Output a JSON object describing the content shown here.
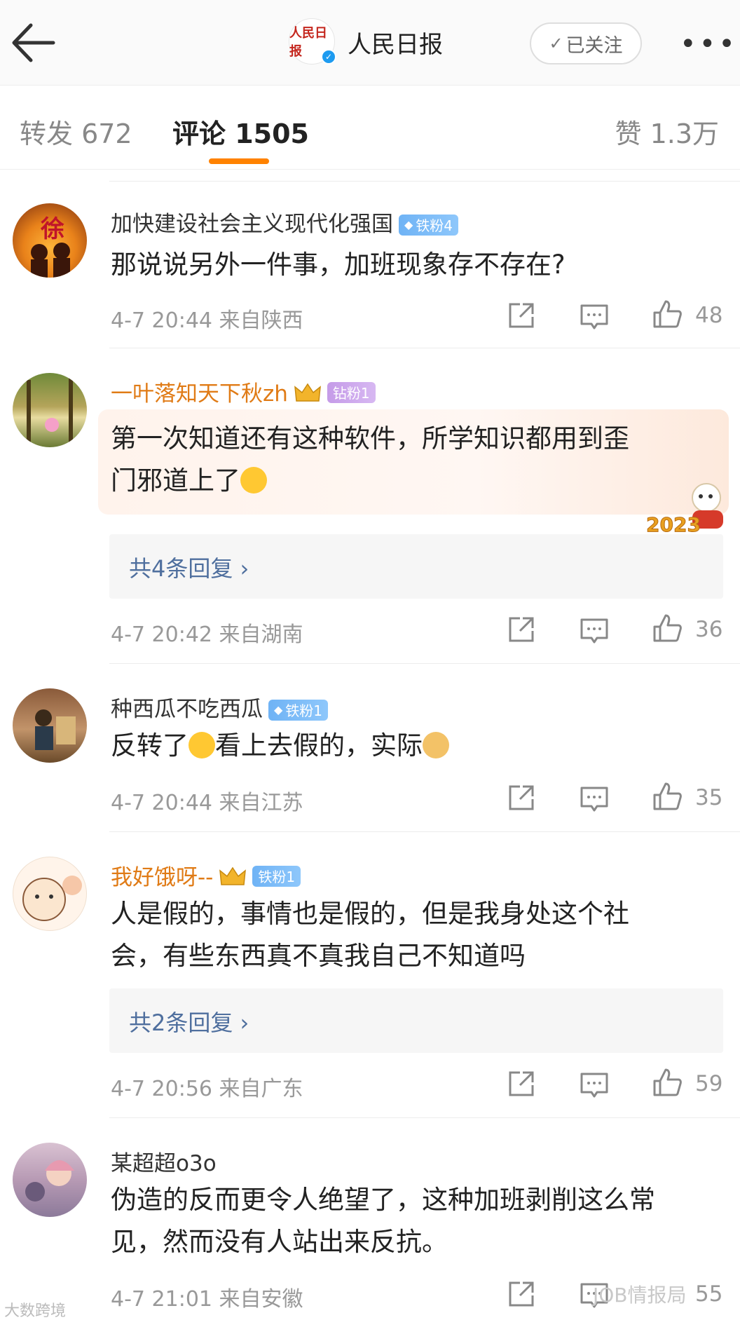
{
  "header": {
    "back_icon": "back-arrow-icon",
    "account_logo_text": "人民日报",
    "account_name": "人民日报",
    "follow_label": "已关注",
    "more_icon": "more-dots-icon"
  },
  "tabs": {
    "repost": "转发 672",
    "comment": "评论 1505",
    "like": "赞 1.3万"
  },
  "comments": [
    {
      "username": "加快建设社会主义现代化强国",
      "badge": "铁粉4",
      "text": "那说说另外一件事，加班现象存不存在?",
      "time_location": "4-7 20:44  来自陕西",
      "likes": "48",
      "avatar_text": "徐"
    },
    {
      "username": "一叶落知天下秋zh",
      "badge": "钻粉1",
      "text_line1": "第一次知道还有这种软件，所学知识都用到歪",
      "text_line2": "门邪道上了",
      "sticker_text": "2023",
      "replies": "共4条回复 ›",
      "time_location": "4-7 20:42  来自湖南",
      "likes": "36"
    },
    {
      "username": "种西瓜不吃西瓜",
      "badge": "铁粉1",
      "text_a": "反转了",
      "text_b": "看上去假的，实际",
      "time_location": "4-7 20:44  来自江苏",
      "likes": "35"
    },
    {
      "username": "我好饿呀--",
      "badge": "铁粉1",
      "text_line1": "人是假的，事情也是假的，但是我身处这个社",
      "text_line2": "会，有些东西真不真我自己不知道吗",
      "replies": "共2条回复 ›",
      "time_location": "4-7 20:56  来自广东",
      "likes": "59"
    },
    {
      "username": "某超超o3o",
      "text_line1": "伪造的反而更令人绝望了，这种加班剥削这么常",
      "text_line2": "见，然而没有人站出来反抗。",
      "time_location": "4-7 21:01  来自安徽",
      "likes": "55"
    }
  ],
  "watermarks": {
    "left": "大数跨境",
    "right": "JOB情报局"
  },
  "colors": {
    "accent": "#ff8200",
    "vip_name": "#e07b16",
    "reply_link": "#4f6f9e",
    "iron_badge": "#6fb3f5",
    "diamond_badge": "#c59be8"
  }
}
